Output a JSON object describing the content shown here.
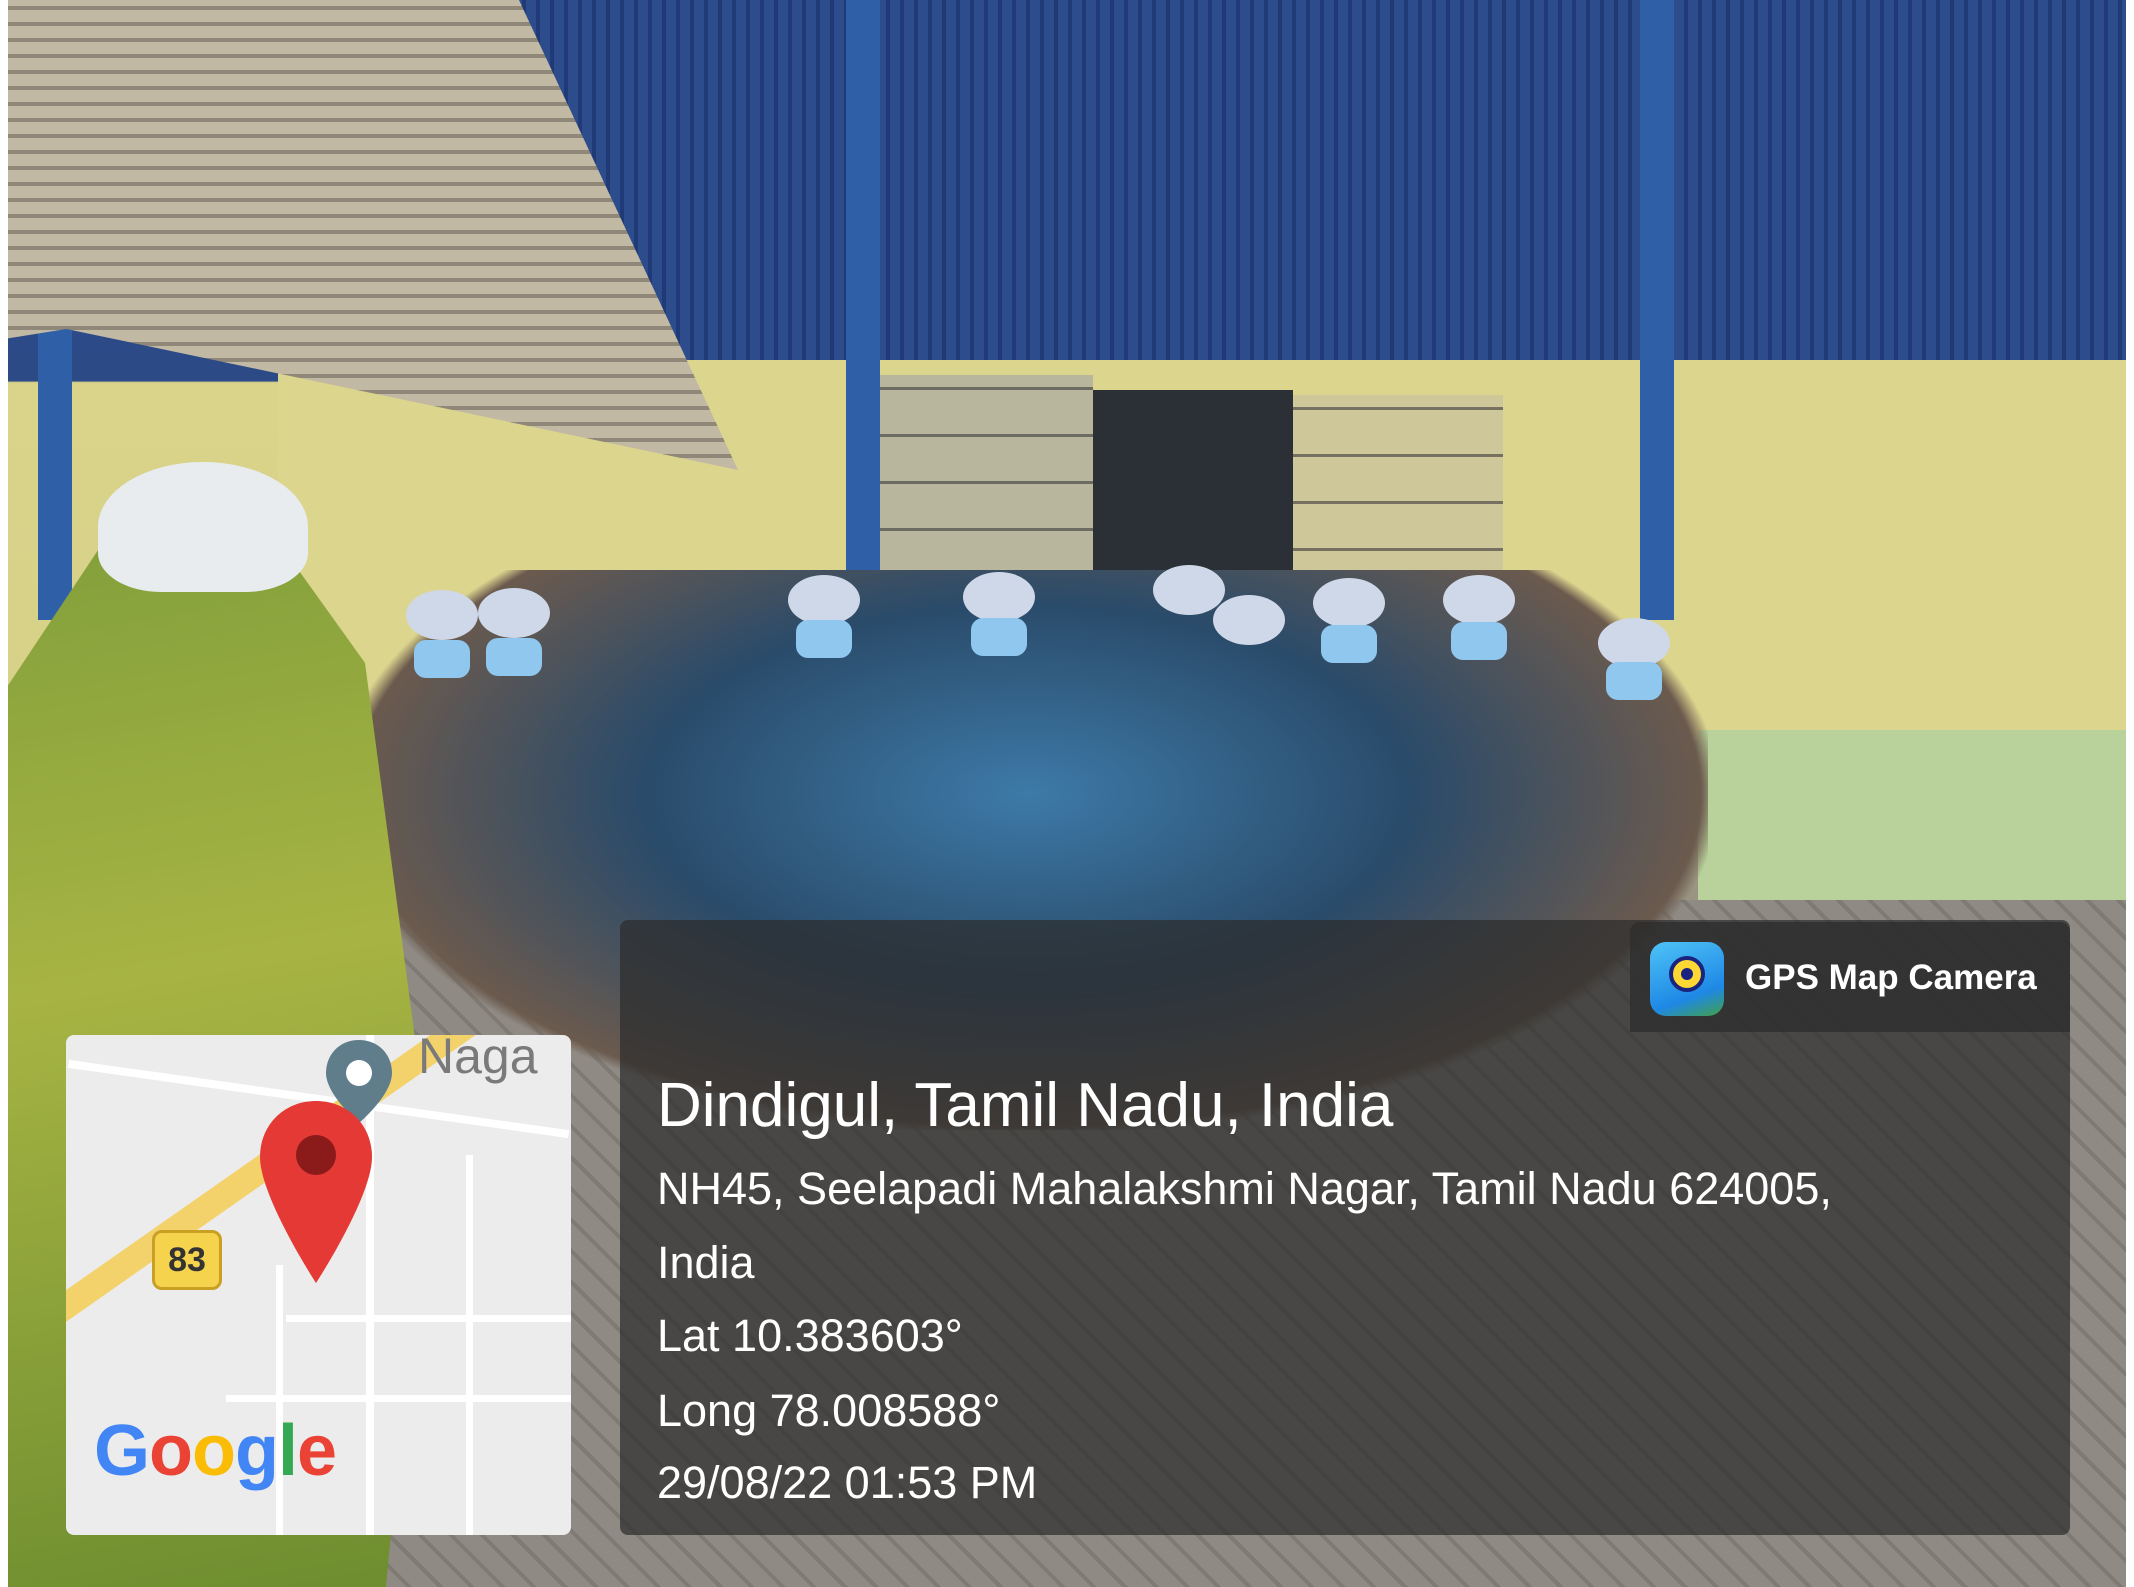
{
  "app": {
    "name": "GPS Map Camera",
    "icon": "camera-location-icon"
  },
  "location": {
    "title": "Dindigul, Tamil Nadu, India",
    "address_line_1": "NH45, Seelapadi Mahalakshmi Nagar, Tamil Nadu 624005,",
    "address_line_2": "India",
    "latitude": "Lat 10.383603°",
    "longitude": "Long 78.008588°",
    "datetime": "29/08/22 01:53 PM"
  },
  "map": {
    "place_label": "Naga",
    "route_number": "83",
    "logo": {
      "letters": [
        "G",
        "o",
        "o",
        "g",
        "l",
        "e"
      ],
      "colors": [
        "#4285F4",
        "#EA4335",
        "#FBBC05",
        "#4285F4",
        "#34A853",
        "#EA4335"
      ]
    },
    "marker_color": "#E53935",
    "secondary_marker_color": "#607D8B",
    "highway_color": "#F3D26C"
  },
  "photo": {
    "description_icon": "photo-background"
  }
}
